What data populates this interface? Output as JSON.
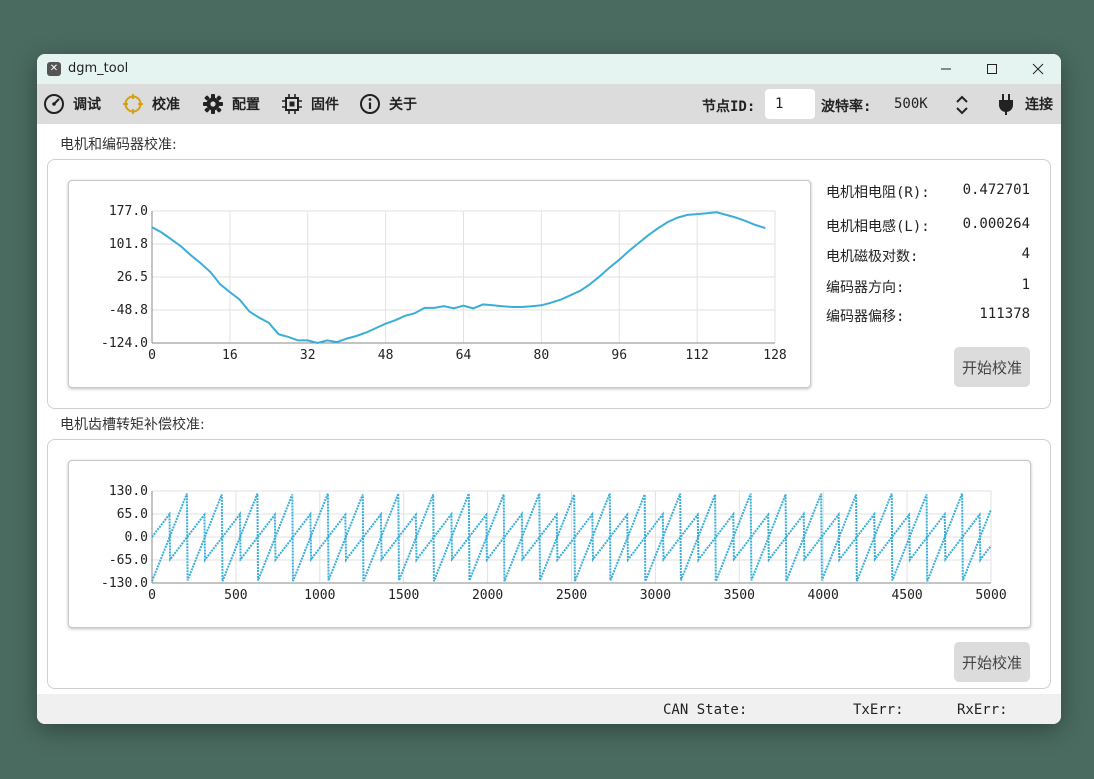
{
  "window": {
    "title": "dgm_tool"
  },
  "toolbar": {
    "items": [
      {
        "label": "调试",
        "icon": "gauge-icon"
      },
      {
        "label": "校准",
        "icon": "crosshair-icon"
      },
      {
        "label": "配置",
        "icon": "gear-icon"
      },
      {
        "label": "固件",
        "icon": "chip-icon"
      },
      {
        "label": "关于",
        "icon": "info-icon"
      }
    ],
    "node_id_label": "节点ID:",
    "node_id_value": "1",
    "baud_label": "波特率:",
    "baud_value": "500K",
    "connect_label": "连接"
  },
  "motor_section": {
    "title": "电机和编码器校准:",
    "params": [
      {
        "label": "电机相电阻(R):",
        "value": "0.472701"
      },
      {
        "label": "电机相电感(L):",
        "value": "0.000264"
      },
      {
        "label": "电机磁极对数:",
        "value": "4"
      },
      {
        "label": "编码器方向:",
        "value": "1"
      },
      {
        "label": "编码器偏移:",
        "value": "111378"
      }
    ],
    "button_label": "开始校准"
  },
  "cogging_section": {
    "title": "电机齿槽转矩补偿校准:",
    "button_label": "开始校准"
  },
  "status": {
    "can_state_label": "CAN State:",
    "txerr_label": "TxErr:",
    "rxerr_label": "RxErr:"
  },
  "colors": {
    "line": "#3aaed8",
    "accent": "#d4a017"
  },
  "chart_data": [
    {
      "type": "line",
      "xlim": [
        0,
        128
      ],
      "ylim": [
        -124.0,
        177.0
      ],
      "xticks": [
        "0",
        "16",
        "32",
        "48",
        "64",
        "80",
        "96",
        "112",
        "128"
      ],
      "yticks": [
        "177.0",
        "101.8",
        "26.5",
        "-48.8",
        "-124.0"
      ],
      "grid": true,
      "series": [
        {
          "x": [
            0,
            2,
            4,
            6,
            8,
            10,
            12,
            14,
            16,
            18,
            20,
            22,
            24,
            26,
            28,
            30,
            32,
            34,
            36,
            38,
            40,
            42,
            44,
            46,
            48,
            50,
            52,
            54,
            56,
            58,
            60,
            62,
            64,
            66,
            68,
            70,
            72,
            74,
            76,
            78,
            80,
            82,
            84,
            86,
            88,
            90,
            92,
            94,
            96,
            98,
            100,
            102,
            104,
            106,
            108,
            110,
            112,
            114,
            116,
            118,
            120,
            122,
            124,
            126
          ],
          "y": [
            140,
            128,
            112,
            96,
            76,
            58,
            38,
            10,
            -8,
            -25,
            -52,
            -66,
            -78,
            -104,
            -110,
            -118,
            -118,
            -124,
            -118,
            -122,
            -114,
            -108,
            -100,
            -90,
            -80,
            -72,
            -62,
            -56,
            -44,
            -44,
            -40,
            -45,
            -39,
            -45,
            -36,
            -38,
            -40,
            -42,
            -42,
            -40,
            -38,
            -32,
            -25,
            -15,
            -5,
            10,
            28,
            48,
            66,
            86,
            104,
            122,
            138,
            152,
            162,
            168,
            170,
            172,
            174,
            168,
            162,
            154,
            145,
            138
          ]
        }
      ]
    },
    {
      "type": "scatter",
      "xlim": [
        0,
        5000
      ],
      "ylim": [
        -130.0,
        130.0
      ],
      "xticks": [
        "0",
        "500",
        "1000",
        "1500",
        "2000",
        "2500",
        "3000",
        "3500",
        "4000",
        "4500",
        "5000"
      ],
      "yticks": [
        "130.0",
        "65.0",
        "0.0",
        "-65.0",
        "-130.0"
      ],
      "grid": true,
      "series": [
        {
          "pattern": "sawtooth",
          "period": 210,
          "amplitude": 125
        },
        {
          "pattern": "sawtooth",
          "period": 210,
          "amplitude": 65,
          "phase": 105
        }
      ]
    }
  ]
}
